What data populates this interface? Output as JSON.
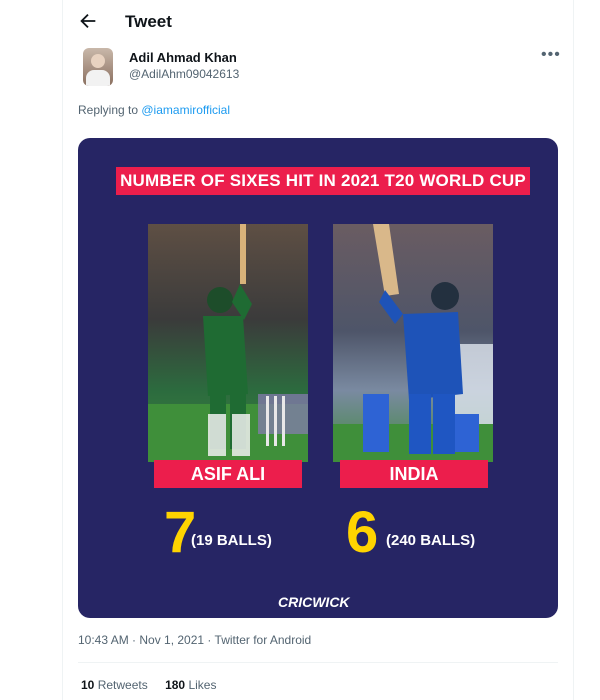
{
  "header": {
    "title": "Tweet"
  },
  "author": {
    "name": "Adil Ahmad Khan",
    "handle": "@AdilAhm09042613"
  },
  "reply": {
    "prefix": "Replying to ",
    "mention": "@iamamirofficial"
  },
  "graphic": {
    "banner": "NUMBER OF SIXES HIT IN 2021 T20 WORLD CUP",
    "left": {
      "label": "ASIF ALI",
      "value": "7",
      "balls": "(19 BALLS)"
    },
    "right": {
      "label": "INDIA",
      "value": "6",
      "balls": "(240 BALLS)"
    },
    "logo": "CRICWICK"
  },
  "meta": {
    "text": "10:43 AM · Nov 1, 2021 · Twitter for Android"
  },
  "stats": {
    "retweets_count": "10",
    "retweets_label": "Retweets",
    "likes_count": "180",
    "likes_label": "Likes"
  },
  "colors": {
    "accent": "#1d9bf0",
    "media_bg": "#262564",
    "banner": "#ec1e4c",
    "highlight": "#ffd400"
  }
}
